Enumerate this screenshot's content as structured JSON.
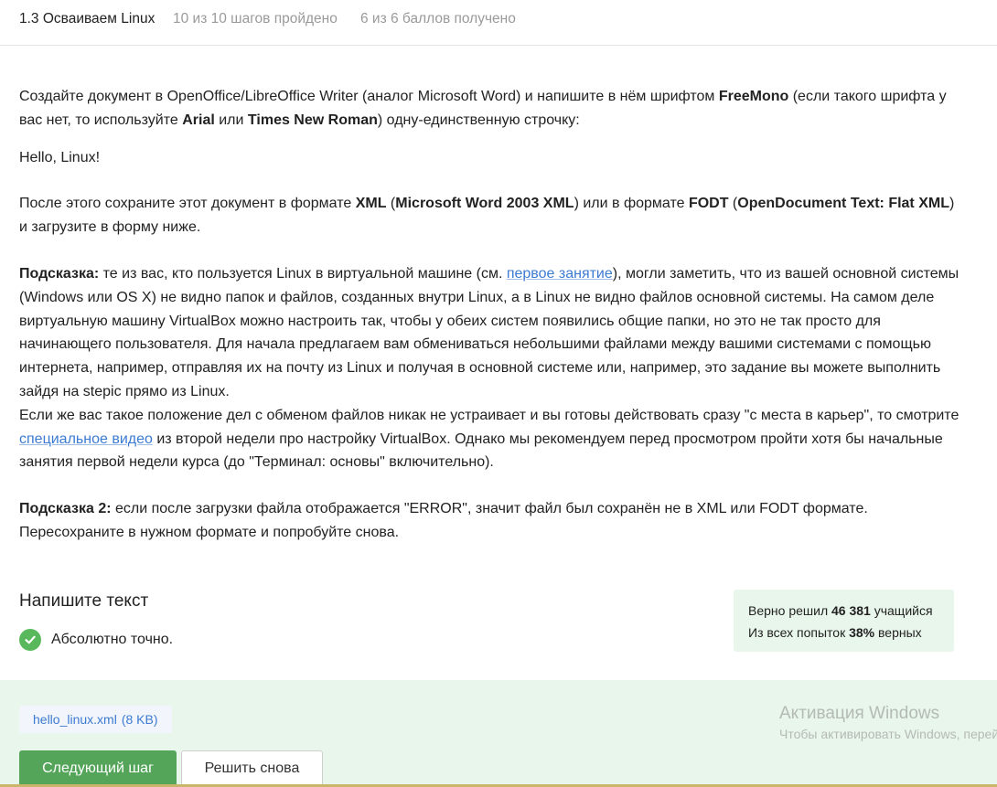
{
  "header": {
    "lesson_title": "1.3 Осваиваем Linux",
    "steps_progress": "10 из 10 шагов пройдено",
    "score_progress": "6 из 6 баллов  получено"
  },
  "step": {
    "p1": {
      "t1": "Создайте документ в OpenOffice/LibreOffice Writer (аналог Microsoft Word) и напишите в нём шрифтом ",
      "b1": "FreeMono",
      "t2": " (если такого шрифта у вас нет, то используйте ",
      "b2": "Arial",
      "t3": " или ",
      "b3": "Times New Roman",
      "t4": ") одну-единственную строчку:"
    },
    "hello_line": "Hello, Linux!",
    "p2": {
      "t1": "После этого сохраните этот документ в формате ",
      "b1": "XML",
      "t2": " (",
      "b2": "Microsoft Word 2003 XML",
      "t3": ") или в формате ",
      "b3": "FODT",
      "t4": " (",
      "b4": "OpenDocument Text: Flat XML",
      "t5": ") и загрузите в форму ниже."
    },
    "hint1": {
      "label": "Подсказка:",
      "t1": " те из вас, кто пользуется Linux в виртуальной машине (см. ",
      "link1": "первое занятие",
      "t2": "), могли заметить, что из вашей основной системы (Windows или OS X) не видно папок и файлов, созданных внутри Linux, а в Linux не видно файлов основной системы. На самом деле виртуальную машину VirtualBox можно настроить так, чтобы у обеих систем появились общие папки, но это не так просто для начинающего пользователя. Для начала предлагаем вам обмениваться небольшими файлами между вашими системами с помощью интернета, например, отправляя их на почту из Linux и получая в основной системе или, например, это задание вы можете выполнить зайдя на stepic прямо из Linux.",
      "t3": "Если же вас такое положение дел с обменом файлов никак не устраивает и вы готовы действовать сразу \"с места в карьер\", то смотрите ",
      "link2": "специальное видео",
      "t4": " из второй недели про настройку VirtualBox. Однако мы рекомендуем перед просмотром пройти хотя бы начальные занятия первой недели курса (до \"Терминал: основы\" включительно)."
    },
    "hint2": {
      "label": "Подсказка 2:",
      "t1": " если после загрузки файла отображается \"ERROR\", значит файл был сохранён не в XML или FODT формате. Пересохраните в нужном формате и попробуйте снова."
    }
  },
  "answer": {
    "title": "Напишите текст",
    "result": "Абсолютно точно.",
    "result_icon": "check-circle-icon",
    "success_color": "#59b85c"
  },
  "stats": {
    "solved_prefix": "Верно решил ",
    "solved_count": "46 381",
    "solved_suffix": " учащийся",
    "attempts_prefix": "Из всех попыток ",
    "attempts_percent": "38%",
    "attempts_suffix": " верных"
  },
  "submission": {
    "file_name": "hello_linux.xml",
    "file_size": "(8 KB)",
    "next_button": "Следующий шаг",
    "retry_button": "Решить снова"
  },
  "watermark": {
    "title": "Активация Windows",
    "subtitle": "Чтобы активировать Windows, перейдите в раздел «Параметры»."
  }
}
